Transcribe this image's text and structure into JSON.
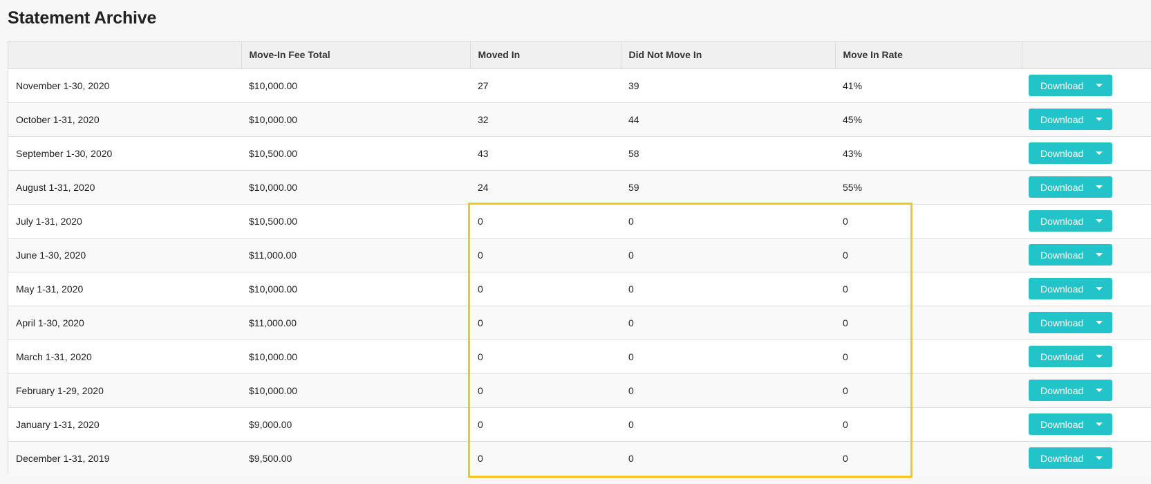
{
  "page": {
    "title": "Statement Archive"
  },
  "table": {
    "columns": [
      "",
      "Move-In Fee Total",
      "Moved In",
      "Did Not Move In",
      "Move In Rate",
      ""
    ],
    "rows": [
      {
        "period": "November 1-30, 2020",
        "fee": "$10,000.00",
        "moved_in": "27",
        "not_moved_in": "39",
        "rate": "41%",
        "action": "Download"
      },
      {
        "period": "October 1-31, 2020",
        "fee": "$10,000.00",
        "moved_in": "32",
        "not_moved_in": "44",
        "rate": "45%",
        "action": "Download"
      },
      {
        "period": "September 1-30, 2020",
        "fee": "$10,500.00",
        "moved_in": "43",
        "not_moved_in": "58",
        "rate": "43%",
        "action": "Download"
      },
      {
        "period": "August 1-31, 2020",
        "fee": "$10,000.00",
        "moved_in": "24",
        "not_moved_in": "59",
        "rate": "55%",
        "action": "Download"
      },
      {
        "period": "July 1-31, 2020",
        "fee": "$10,500.00",
        "moved_in": "0",
        "not_moved_in": "0",
        "rate": "0",
        "action": "Download"
      },
      {
        "period": "June 1-30, 2020",
        "fee": "$11,000.00",
        "moved_in": "0",
        "not_moved_in": "0",
        "rate": "0",
        "action": "Download"
      },
      {
        "period": "May 1-31, 2020",
        "fee": "$10,000.00",
        "moved_in": "0",
        "not_moved_in": "0",
        "rate": "0",
        "action": "Download"
      },
      {
        "period": "April 1-30, 2020",
        "fee": "$11,000.00",
        "moved_in": "0",
        "not_moved_in": "0",
        "rate": "0",
        "action": "Download"
      },
      {
        "period": "March 1-31, 2020",
        "fee": "$10,000.00",
        "moved_in": "0",
        "not_moved_in": "0",
        "rate": "0",
        "action": "Download"
      },
      {
        "period": "February 1-29, 2020",
        "fee": "$10,000.00",
        "moved_in": "0",
        "not_moved_in": "0",
        "rate": "0",
        "action": "Download"
      },
      {
        "period": "January 1-31, 2020",
        "fee": "$9,000.00",
        "moved_in": "0",
        "not_moved_in": "0",
        "rate": "0",
        "action": "Download"
      },
      {
        "period": "December 1-31, 2019",
        "fee": "$9,500.00",
        "moved_in": "0",
        "not_moved_in": "0",
        "rate": "0",
        "action": "Download"
      }
    ]
  },
  "colors": {
    "accent": "#22c4c9",
    "highlight": "#f5c518"
  },
  "icons": {
    "download_caret": "chevron-down-icon"
  }
}
